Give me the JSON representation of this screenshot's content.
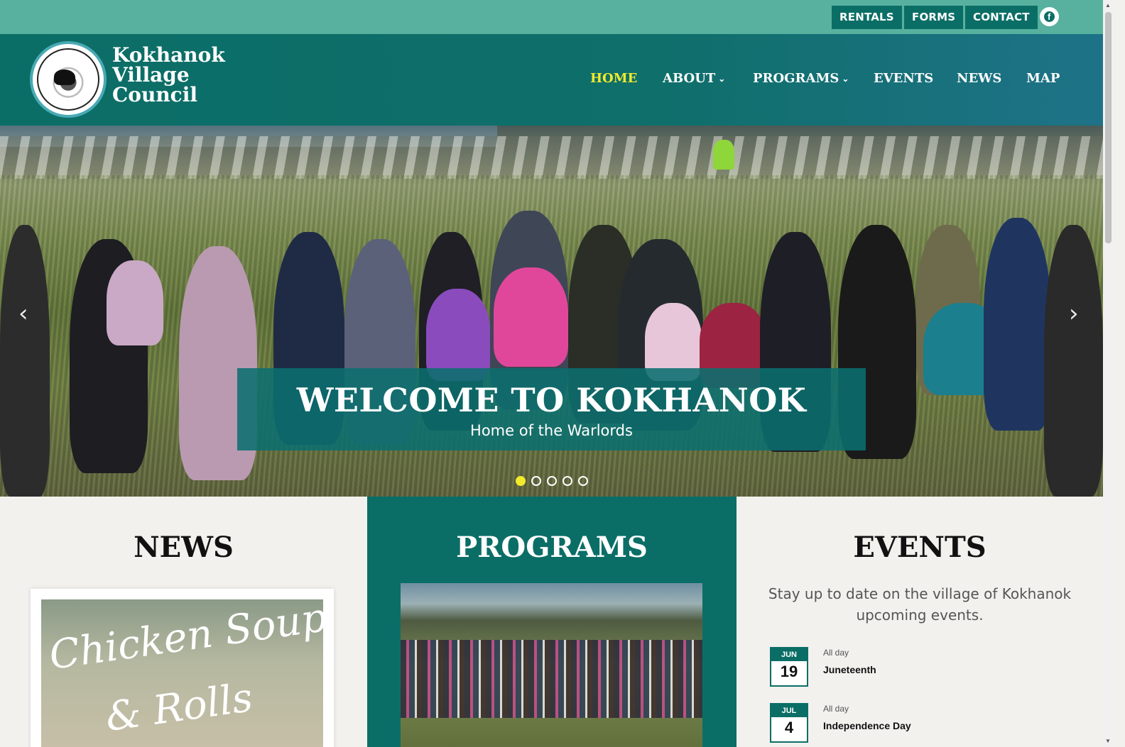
{
  "topbar": {
    "links": [
      "RENTALS",
      "FORMS",
      "CONTACT"
    ],
    "social_icon": "facebook-icon"
  },
  "brand": {
    "line1": "Kokhanok",
    "line2": "Village",
    "line3": "Council"
  },
  "nav": {
    "home": "HOME",
    "about": "ABOUT",
    "programs": "PROGRAMS",
    "events": "EVENTS",
    "news": "NEWS",
    "map": "MAP"
  },
  "hero": {
    "title": "WELCOME TO KOKHANOK",
    "subtitle": "Home of the Warlords",
    "slide_count": 5,
    "active_slide": 1,
    "prev_icon": "chevron-left-icon",
    "next_icon": "chevron-right-icon"
  },
  "news": {
    "title": "NEWS",
    "card_image_text1": "Chicken Soup",
    "card_image_text2": "& Rolls"
  },
  "programs": {
    "title": "PROGRAMS"
  },
  "events": {
    "title": "EVENTS",
    "intro": "Stay up to date on the village of Kokhanok upcoming events.",
    "items": [
      {
        "month": "JUN",
        "day": "19",
        "when": "All day",
        "name": "Juneteenth"
      },
      {
        "month": "JUL",
        "day": "4",
        "when": "All day",
        "name": "Independence Day"
      }
    ]
  },
  "colors": {
    "teal_dark": "#0b6e66",
    "topbar_teal": "#57b19e",
    "accent_yellow": "#f3ea2c"
  }
}
